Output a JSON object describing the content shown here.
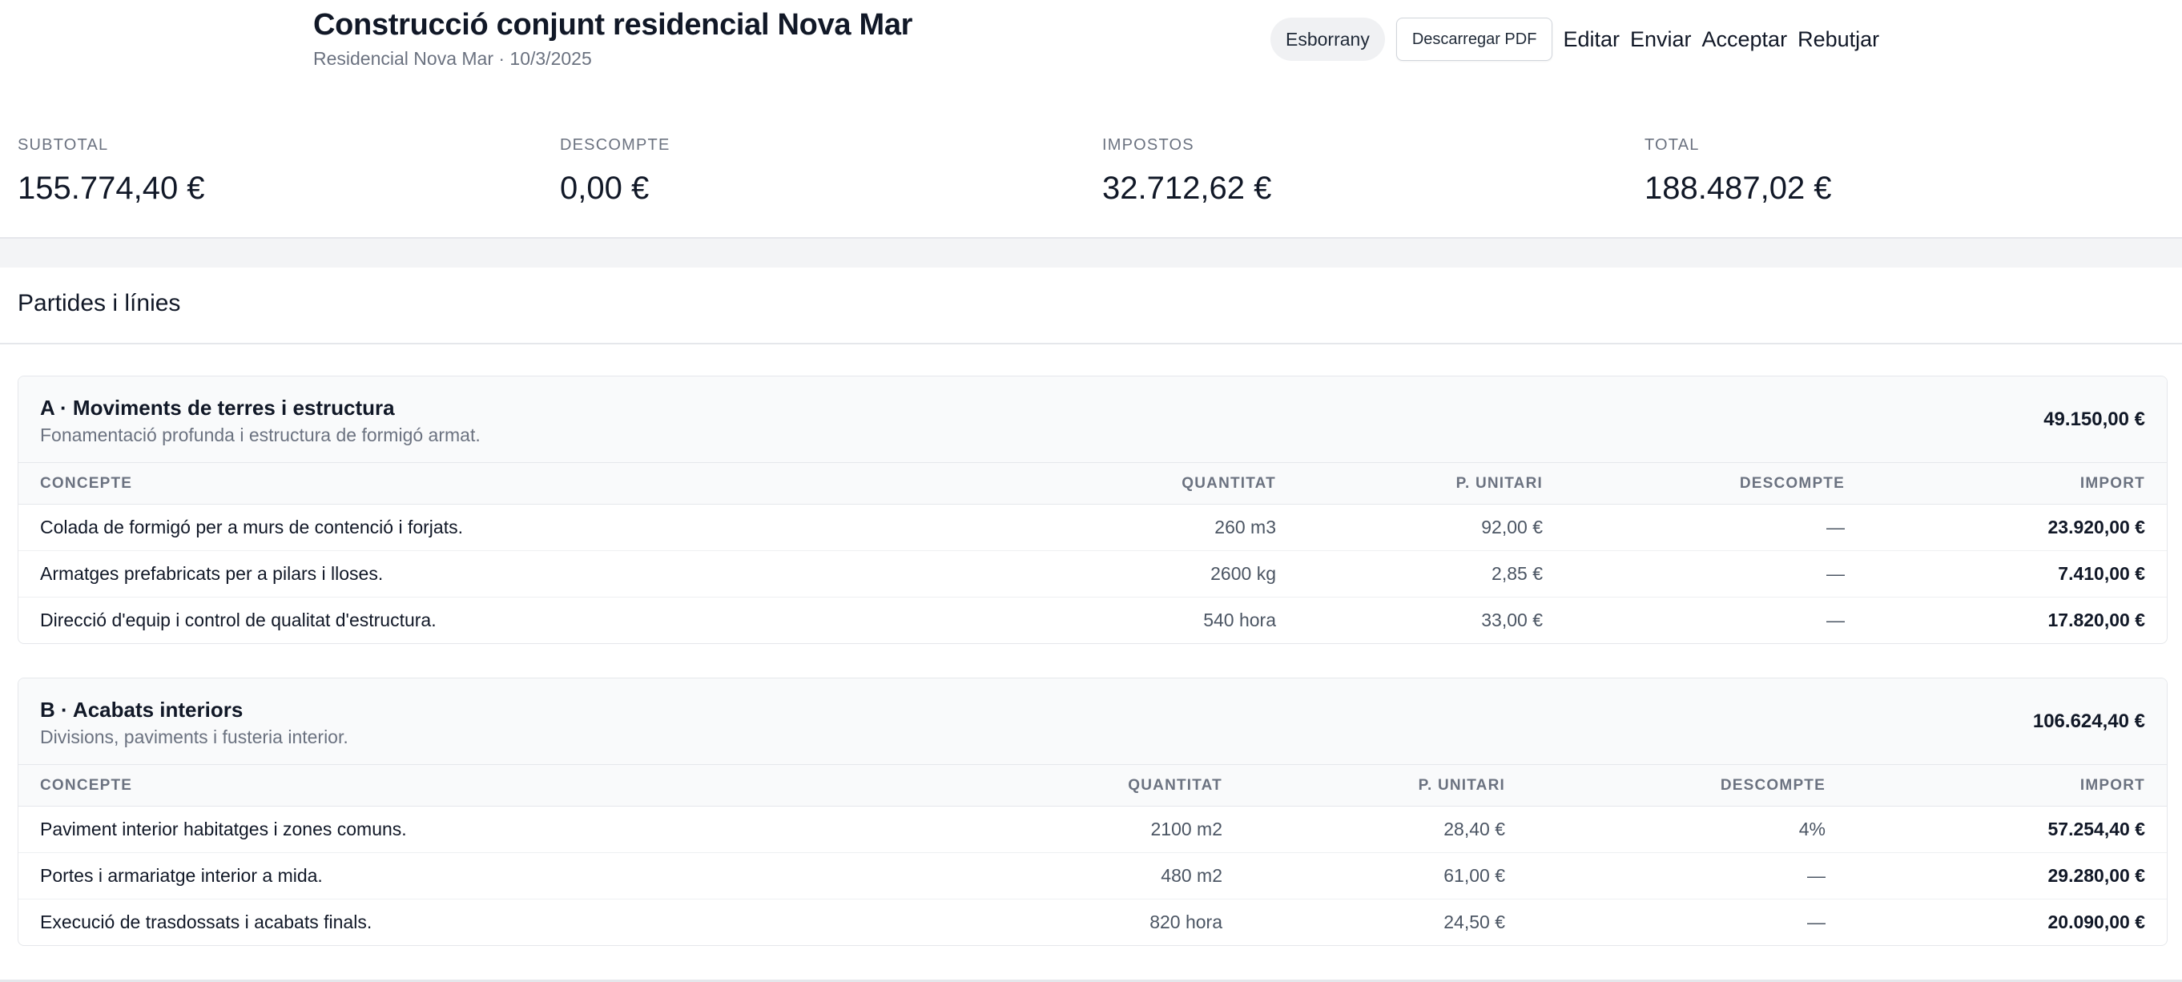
{
  "header": {
    "title": "Construcció conjunt residencial Nova Mar",
    "subtitle": "Residencial Nova Mar · 10/3/2025",
    "status": "Esborrany",
    "pdf_button": "Descarregar PDF",
    "actions": {
      "edit": "Editar",
      "send": "Enviar",
      "accept": "Acceptar",
      "reject": "Rebutjar"
    }
  },
  "summary": {
    "subtotal": {
      "label": "SUBTOTAL",
      "value": "155.774,40 €"
    },
    "discount": {
      "label": "DESCOMPTE",
      "value": "0,00 €"
    },
    "taxes": {
      "label": "IMPOSTOS",
      "value": "32.712,62 €"
    },
    "total": {
      "label": "TOTAL",
      "value": "188.487,02 €"
    }
  },
  "section": {
    "heading": "Partides i línies"
  },
  "columns": {
    "concept": "CONCEPTE",
    "quantity": "QUANTITAT",
    "unit_price": "P. UNITARI",
    "discount": "DESCOMPTE",
    "amount": "IMPORT"
  },
  "partides": [
    {
      "title": "A · Moviments de terres i estructura",
      "description": "Fonamentació profunda i estructura de formigó armat.",
      "total": "49.150,00 €",
      "lines": [
        {
          "concept": "Colada de formigó per a murs de contenció i forjats.",
          "quantity": "260 m3",
          "unit_price": "92,00 €",
          "discount": "—",
          "amount": "23.920,00 €"
        },
        {
          "concept": "Armatges prefabricats per a pilars i lloses.",
          "quantity": "2600 kg",
          "unit_price": "2,85 €",
          "discount": "—",
          "amount": "7.410,00 €"
        },
        {
          "concept": "Direcció d'equip i control de qualitat d'estructura.",
          "quantity": "540 hora",
          "unit_price": "33,00 €",
          "discount": "—",
          "amount": "17.820,00 €"
        }
      ]
    },
    {
      "title": "B · Acabats interiors",
      "description": "Divisions, paviments i fusteria interior.",
      "total": "106.624,40 €",
      "lines": [
        {
          "concept": "Paviment interior habitatges i zones comuns.",
          "quantity": "2100 m2",
          "unit_price": "28,40 €",
          "discount": "4%",
          "amount": "57.254,40 €"
        },
        {
          "concept": "Portes i armariatge interior a mida.",
          "quantity": "480 m2",
          "unit_price": "61,00 €",
          "discount": "—",
          "amount": "29.280,00 €"
        },
        {
          "concept": "Execució de trasdossats i acabats finals.",
          "quantity": "820 hora",
          "unit_price": "24,50 €",
          "discount": "—",
          "amount": "20.090,00 €"
        }
      ]
    }
  ]
}
